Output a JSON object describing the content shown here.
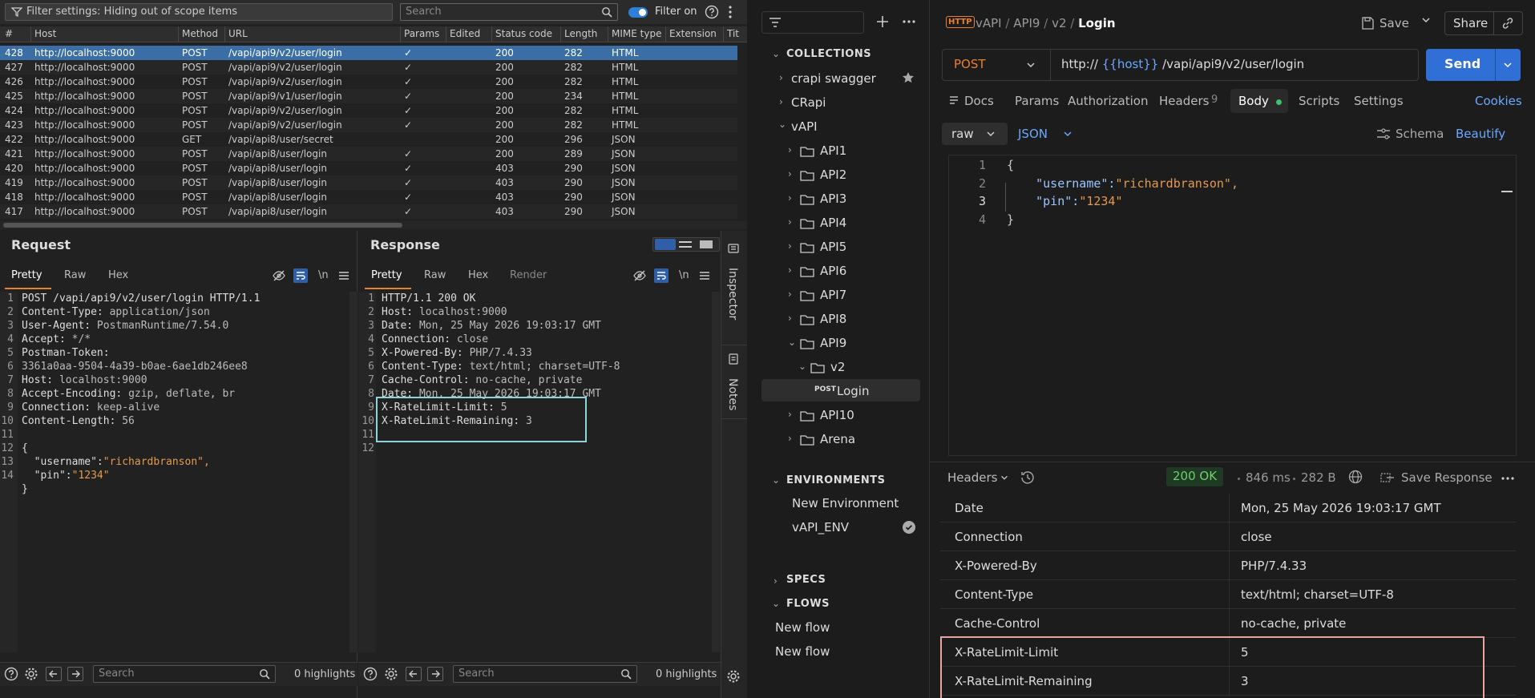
{
  "burp": {
    "filter_text": "Filter settings: Hiding out of scope items",
    "search_placeholder": "Search",
    "filter_on_label": "Filter on",
    "columns": [
      "#",
      "Host",
      "Method",
      "URL",
      "Params",
      "Edited",
      "Status code",
      "Length",
      "MIME type",
      "Extension",
      "Tit"
    ],
    "rows": [
      {
        "id": "428",
        "host": "http://localhost:9000",
        "method": "POST",
        "url": "/vapi/api9/v2/user/login",
        "params": "✓",
        "status": "200",
        "length": "282",
        "mime": "HTML"
      },
      {
        "id": "427",
        "host": "http://localhost:9000",
        "method": "POST",
        "url": "/vapi/api9/v2/user/login",
        "params": "✓",
        "status": "200",
        "length": "282",
        "mime": "HTML"
      },
      {
        "id": "426",
        "host": "http://localhost:9000",
        "method": "POST",
        "url": "/vapi/api9/v2/user/login",
        "params": "✓",
        "status": "200",
        "length": "282",
        "mime": "HTML"
      },
      {
        "id": "425",
        "host": "http://localhost:9000",
        "method": "POST",
        "url": "/vapi/api9/v1/user/login",
        "params": "✓",
        "status": "200",
        "length": "234",
        "mime": "HTML"
      },
      {
        "id": "424",
        "host": "http://localhost:9000",
        "method": "POST",
        "url": "/vapi/api9/v2/user/login",
        "params": "✓",
        "status": "200",
        "length": "282",
        "mime": "HTML"
      },
      {
        "id": "423",
        "host": "http://localhost:9000",
        "method": "POST",
        "url": "/vapi/api9/v2/user/login",
        "params": "✓",
        "status": "200",
        "length": "282",
        "mime": "HTML"
      },
      {
        "id": "422",
        "host": "http://localhost:9000",
        "method": "GET",
        "url": "/vapi/api8/user/secret",
        "params": "",
        "status": "200",
        "length": "296",
        "mime": "JSON"
      },
      {
        "id": "421",
        "host": "http://localhost:9000",
        "method": "POST",
        "url": "/vapi/api8/user/login",
        "params": "✓",
        "status": "200",
        "length": "289",
        "mime": "JSON"
      },
      {
        "id": "420",
        "host": "http://localhost:9000",
        "method": "POST",
        "url": "/vapi/api8/user/login",
        "params": "✓",
        "status": "403",
        "length": "290",
        "mime": "JSON"
      },
      {
        "id": "419",
        "host": "http://localhost:9000",
        "method": "POST",
        "url": "/vapi/api8/user/login",
        "params": "✓",
        "status": "403",
        "length": "290",
        "mime": "JSON"
      },
      {
        "id": "418",
        "host": "http://localhost:9000",
        "method": "POST",
        "url": "/vapi/api8/user/login",
        "params": "✓",
        "status": "403",
        "length": "290",
        "mime": "JSON"
      },
      {
        "id": "417",
        "host": "http://localhost:9000",
        "method": "POST",
        "url": "/vapi/api8/user/login",
        "params": "✓",
        "status": "403",
        "length": "290",
        "mime": "JSON"
      }
    ],
    "request": {
      "title": "Request",
      "tabs": [
        "Pretty",
        "Raw",
        "Hex"
      ],
      "newline_label": "\\n",
      "line_numbers": [
        "1",
        "2",
        "3",
        "4",
        "5",
        "",
        "6",
        "7",
        "8",
        "9",
        "10",
        "11",
        "12",
        "13",
        "14"
      ],
      "lines": [
        {
          "k": "POST /vapi/api9/v2/user/login HTTP/1.1",
          "v": ""
        },
        {
          "k": "Content-Type: ",
          "v": "application/json"
        },
        {
          "k": "User-Agent: ",
          "v": "PostmanRuntime/7.54.0"
        },
        {
          "k": "Accept: ",
          "v": "*/*"
        },
        {
          "k": "Postman-Token: ",
          "v": ""
        },
        {
          "k": "",
          "v": "3361a0aa-9504-4a39-b0ae-6ae1db246ee8"
        },
        {
          "k": "Host: ",
          "v": "localhost:9000"
        },
        {
          "k": "Accept-Encoding: ",
          "v": "gzip, deflate, br"
        },
        {
          "k": "Connection: ",
          "v": "keep-alive"
        },
        {
          "k": "Content-Length: ",
          "v": "56"
        },
        {
          "k": "",
          "v": ""
        },
        {
          "k": "{",
          "v": ""
        },
        {
          "k": "  \"username\":",
          "v": "\"richardbranson\","
        },
        {
          "k": "  \"pin\":",
          "v": "\"1234\""
        },
        {
          "k": "}",
          "v": ""
        }
      ]
    },
    "response": {
      "title": "Response",
      "tabs": [
        "Pretty",
        "Raw",
        "Hex",
        "Render"
      ],
      "newline_label": "\\n",
      "line_numbers": [
        "1",
        "2",
        "3",
        "4",
        "5",
        "6",
        "7",
        "8",
        "9",
        "10",
        "11",
        "12"
      ],
      "lines": [
        {
          "k": "HTTP/1.1 200 OK",
          "v": ""
        },
        {
          "k": "Host: ",
          "v": "localhost:9000"
        },
        {
          "k": "Date: ",
          "v": "Mon, 25 May 2026 19:03:17 GMT"
        },
        {
          "k": "Connection: ",
          "v": "close"
        },
        {
          "k": "X-Powered-By: ",
          "v": "PHP/7.4.33"
        },
        {
          "k": "Content-Type: ",
          "v": "text/html; charset=UTF-8"
        },
        {
          "k": "Cache-Control: ",
          "v": "no-cache, private"
        },
        {
          "k": "Date: ",
          "v": "Mon, 25 May 2026 19:03:17 GMT"
        },
        {
          "k": "X-RateLimit-Limit: ",
          "v": "5"
        },
        {
          "k": "X-RateLimit-Remaining: ",
          "v": "3"
        },
        {
          "k": "",
          "v": ""
        },
        {
          "k": "",
          "v": ""
        }
      ]
    },
    "inspector_label": "Inspector",
    "notes_label": "Notes",
    "bottom_search_placeholder": "Search",
    "highlights_label": "0 highlights"
  },
  "postman": {
    "collections_label": "COLLECTIONS",
    "collections": [
      {
        "label": "crapi swagger",
        "starred": true
      },
      {
        "label": "CRapi"
      },
      {
        "label": "vAPI"
      }
    ],
    "folders": [
      "API1",
      "API2",
      "API3",
      "API4",
      "API5",
      "API6",
      "API7",
      "API8",
      "API9"
    ],
    "subfolder": "v2",
    "request_method_tag": "POST",
    "request_name": "Login",
    "folders_after": [
      "API10",
      "Arena"
    ],
    "environments_label": "ENVIRONMENTS",
    "environments": [
      "New Environment",
      "vAPI_ENV"
    ],
    "specs_label": "SPECS",
    "flows_label": "FLOWS",
    "flows": [
      "New flow",
      "New flow"
    ],
    "breadcrumb": [
      "vAPI",
      "API9",
      "v2",
      "Login"
    ],
    "save_label": "Save",
    "share_label": "Share",
    "method": "POST",
    "url_prefix": "http:// ",
    "url_var": "{{host}}",
    "url_path": " /vapi/api9/v2/user/login",
    "send_label": "Send",
    "req_tabs": [
      "Docs",
      "Params",
      "Authorization",
      "Headers",
      "Body",
      "Scripts",
      "Settings"
    ],
    "headers_count": "9",
    "cookies_label": "Cookies",
    "body_mode": "raw",
    "body_lang": "JSON",
    "schema_label": "Schema",
    "beautify_label": "Beautify",
    "body_line_numbers": [
      "1",
      "2",
      "3",
      "4"
    ],
    "body_lines": [
      {
        "k": "{",
        "v": ""
      },
      {
        "k": "    \"username\":",
        "v": "\"richardbranson\","
      },
      {
        "k": "    \"pin\":",
        "v": "\"1234\""
      },
      {
        "k": "}",
        "v": ""
      }
    ],
    "resp_headers_label": "Headers",
    "status": "200 OK",
    "time": "846 ms",
    "size": "282 B",
    "save_response_label": "Save Response",
    "resp_headers": [
      {
        "key": "Date",
        "value": "Mon, 25 May 2026 19:03:17 GMT"
      },
      {
        "key": "Connection",
        "value": "close"
      },
      {
        "key": "X-Powered-By",
        "value": "PHP/7.4.33"
      },
      {
        "key": "Content-Type",
        "value": "text/html; charset=UTF-8"
      },
      {
        "key": "Cache-Control",
        "value": "no-cache, private"
      },
      {
        "key": "X-RateLimit-Limit",
        "value": "5"
      },
      {
        "key": "X-RateLimit-Remaining",
        "value": "3"
      }
    ],
    "colors": {
      "accent": "#2f6fd6",
      "status_ok": "#6fcf6f",
      "highlight_burp": "#8dd5da",
      "highlight_postman": "#e8a3a3",
      "body_dot": "#3cc26a"
    }
  }
}
